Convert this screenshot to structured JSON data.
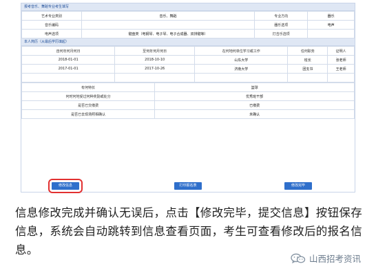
{
  "section1": {
    "title": "报考音乐、舞蹈专业考生填写",
    "row1": {
      "label1": "艺术专业类别",
      "value1": "音乐、舞蹈",
      "label2": "专业方向",
      "value2": "器乐"
    },
    "row2": {
      "label1": "音乐编码",
      "label2": "器乐选项",
      "value2": "电声"
    },
    "row3": {
      "label1": "电声选项",
      "value1": "键盘类（电钢琴、电子琴、电子合成器、双排键等）",
      "label2": "打击乐选项"
    }
  },
  "section2": {
    "title": "本人简历（从最后学历填起）",
    "headers": [
      "自何年何月何日",
      "至何年何月何日",
      "在何地何单位学习或工作",
      "任何职务",
      "证明人"
    ],
    "rows": [
      [
        "2018-01-01",
        "2018-10-10",
        "山东大学",
        "班长",
        "张老师"
      ],
      [
        "2017-01-01",
        "2017-10-26",
        "济南大学",
        "团支书",
        "王老师"
      ]
    ]
  },
  "section3": {
    "rows": [
      {
        "label": "有何特长",
        "value": "篮球"
      },
      {
        "label": "何时何地受过何种奖励或处分",
        "value": "优秀班干部"
      },
      {
        "label": "是否已交缴费",
        "value": "已缴费"
      },
      {
        "label": "是否已去现场照相确认",
        "value": "未确认"
      }
    ]
  },
  "buttons": {
    "modify": "修改信息",
    "print": "打印报名表",
    "done": "修改完毕"
  },
  "caption": "信息修改完成并确认无误后，点击【修改完毕，提交信息】按钮保存信息，系统会自动跳转到信息查看页面，考生可查看修改后的报名信息。",
  "watermark": "山西招考资讯"
}
